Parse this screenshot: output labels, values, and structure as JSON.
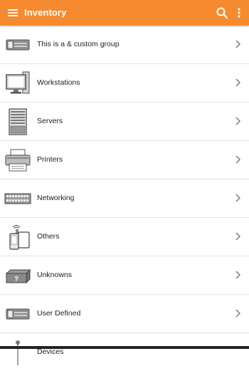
{
  "appbar": {
    "title": "Inventory",
    "bg_color": "#f68a2f",
    "icons": [
      "menu-icon",
      "search-icon",
      "more-vert-icon"
    ]
  },
  "items": [
    {
      "label": "This is a & custom group",
      "icon": "device-box-icon"
    },
    {
      "label": "Workstations",
      "icon": "workstation-icon"
    },
    {
      "label": "Servers",
      "icon": "server-icon"
    },
    {
      "label": "Printers",
      "icon": "printer-icon"
    },
    {
      "label": "Networking",
      "icon": "network-switch-icon"
    },
    {
      "label": "Others",
      "icon": "others-devices-icon"
    },
    {
      "label": "Unknowns",
      "icon": "unknown-box-icon"
    },
    {
      "label": "User Defined",
      "icon": "device-box-icon"
    },
    {
      "label": "Devices",
      "icon": "device-antenna-icon"
    }
  ]
}
